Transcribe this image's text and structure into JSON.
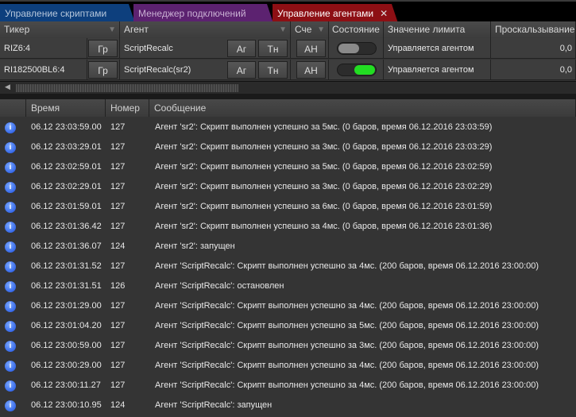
{
  "tabs": [
    {
      "label": "Управление скриптами"
    },
    {
      "label": "Менеджер подключений"
    },
    {
      "label": "Управление агентами",
      "close": "✕"
    }
  ],
  "agents_table": {
    "columns": [
      "Тикер",
      "Агент",
      "Сче",
      "Состояние",
      "Значение лимита",
      "Проскальзывание"
    ],
    "rows": [
      {
        "ticker": "RIZ6:4",
        "chart_btn": "Гр",
        "agent": "ScriptRecalc",
        "agent_btn": "Аг",
        "settings_btn": "Тн",
        "account_btn": "АН",
        "enabled": false,
        "limit": "Управляется агентом",
        "slippage": "0,0"
      },
      {
        "ticker": "RI182500BL6:4",
        "chart_btn": "Гр",
        "agent": "ScriptRecalc(sr2)",
        "agent_btn": "Аг",
        "settings_btn": "Тн",
        "account_btn": "АН",
        "enabled": true,
        "limit": "Управляется агентом",
        "slippage": "0,0"
      }
    ]
  },
  "log": {
    "columns": [
      "Время",
      "Номер",
      "Сообщение"
    ],
    "rows": [
      {
        "time": "06.12 23:03:59.00",
        "num": "127",
        "msg": "Агент 'sr2': Скрипт выполнен успешно за 5мс. (0 баров, время 06.12.2016 23:03:59)"
      },
      {
        "time": "06.12 23:03:29.01",
        "num": "127",
        "msg": "Агент 'sr2': Скрипт выполнен успешно за 3мс. (0 баров, время 06.12.2016 23:03:29)"
      },
      {
        "time": "06.12 23:02:59.01",
        "num": "127",
        "msg": "Агент 'sr2': Скрипт выполнен успешно за 5мс. (0 баров, время 06.12.2016 23:02:59)"
      },
      {
        "time": "06.12 23:02:29.01",
        "num": "127",
        "msg": "Агент 'sr2': Скрипт выполнен успешно за 3мс. (0 баров, время 06.12.2016 23:02:29)"
      },
      {
        "time": "06.12 23:01:59.01",
        "num": "127",
        "msg": "Агент 'sr2': Скрипт выполнен успешно за 6мс. (0 баров, время 06.12.2016 23:01:59)"
      },
      {
        "time": "06.12 23:01:36.42",
        "num": "127",
        "msg": "Агент 'sr2': Скрипт выполнен успешно за 4мс. (0 баров, время 06.12.2016 23:01:36)"
      },
      {
        "time": "06.12 23:01:36.07",
        "num": "124",
        "msg": "Агент 'sr2': запущен"
      },
      {
        "time": "06.12 23:01:31.52",
        "num": "127",
        "msg": "Агент 'ScriptRecalc': Скрипт выполнен успешно за 4мс. (200 баров, время 06.12.2016 23:00:00)"
      },
      {
        "time": "06.12 23:01:31.51",
        "num": "126",
        "msg": "Агент 'ScriptRecalc': остановлен"
      },
      {
        "time": "06.12 23:01:29.00",
        "num": "127",
        "msg": "Агент 'ScriptRecalc': Скрипт выполнен успешно за 4мс. (200 баров, время 06.12.2016 23:00:00)"
      },
      {
        "time": "06.12 23:01:04.20",
        "num": "127",
        "msg": "Агент 'ScriptRecalc': Скрипт выполнен успешно за 5мс. (200 баров, время 06.12.2016 23:00:00)"
      },
      {
        "time": "06.12 23:00:59.00",
        "num": "127",
        "msg": "Агент 'ScriptRecalc': Скрипт выполнен успешно за 3мс. (200 баров, время 06.12.2016 23:00:00)"
      },
      {
        "time": "06.12 23:00:29.00",
        "num": "127",
        "msg": "Агент 'ScriptRecalc': Скрипт выполнен успешно за 4мс. (200 баров, время 06.12.2016 23:00:00)"
      },
      {
        "time": "06.12 23:00:11.27",
        "num": "127",
        "msg": "Агент 'ScriptRecalc': Скрипт выполнен успешно за 4мс. (200 баров, время 06.12.2016 23:00:00)"
      },
      {
        "time": "06.12 23:00:10.95",
        "num": "124",
        "msg": "Агент 'ScriptRecalc': запущен"
      }
    ]
  },
  "colors": {
    "on": "#22dd22",
    "off": "#8a8a8a",
    "info": "#1b4fe0"
  }
}
